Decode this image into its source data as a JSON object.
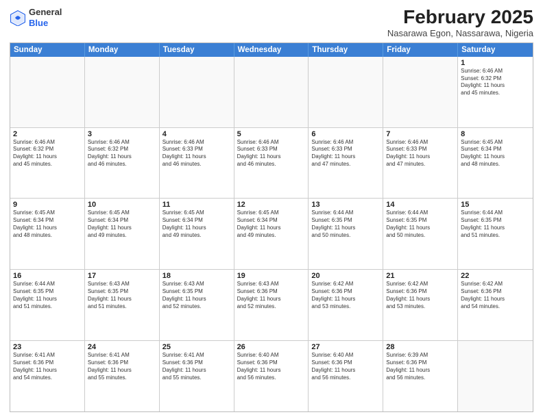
{
  "logo": {
    "general": "General",
    "blue": "Blue"
  },
  "title": "February 2025",
  "location": "Nasarawa Egon, Nassarawa, Nigeria",
  "days": [
    "Sunday",
    "Monday",
    "Tuesday",
    "Wednesday",
    "Thursday",
    "Friday",
    "Saturday"
  ],
  "weeks": [
    [
      {
        "day": "",
        "info": ""
      },
      {
        "day": "",
        "info": ""
      },
      {
        "day": "",
        "info": ""
      },
      {
        "day": "",
        "info": ""
      },
      {
        "day": "",
        "info": ""
      },
      {
        "day": "",
        "info": ""
      },
      {
        "day": "1",
        "info": "Sunrise: 6:46 AM\nSunset: 6:32 PM\nDaylight: 11 hours\nand 45 minutes."
      }
    ],
    [
      {
        "day": "2",
        "info": "Sunrise: 6:46 AM\nSunset: 6:32 PM\nDaylight: 11 hours\nand 45 minutes."
      },
      {
        "day": "3",
        "info": "Sunrise: 6:46 AM\nSunset: 6:32 PM\nDaylight: 11 hours\nand 46 minutes."
      },
      {
        "day": "4",
        "info": "Sunrise: 6:46 AM\nSunset: 6:33 PM\nDaylight: 11 hours\nand 46 minutes."
      },
      {
        "day": "5",
        "info": "Sunrise: 6:46 AM\nSunset: 6:33 PM\nDaylight: 11 hours\nand 46 minutes."
      },
      {
        "day": "6",
        "info": "Sunrise: 6:46 AM\nSunset: 6:33 PM\nDaylight: 11 hours\nand 47 minutes."
      },
      {
        "day": "7",
        "info": "Sunrise: 6:46 AM\nSunset: 6:33 PM\nDaylight: 11 hours\nand 47 minutes."
      },
      {
        "day": "8",
        "info": "Sunrise: 6:45 AM\nSunset: 6:34 PM\nDaylight: 11 hours\nand 48 minutes."
      }
    ],
    [
      {
        "day": "9",
        "info": "Sunrise: 6:45 AM\nSunset: 6:34 PM\nDaylight: 11 hours\nand 48 minutes."
      },
      {
        "day": "10",
        "info": "Sunrise: 6:45 AM\nSunset: 6:34 PM\nDaylight: 11 hours\nand 49 minutes."
      },
      {
        "day": "11",
        "info": "Sunrise: 6:45 AM\nSunset: 6:34 PM\nDaylight: 11 hours\nand 49 minutes."
      },
      {
        "day": "12",
        "info": "Sunrise: 6:45 AM\nSunset: 6:34 PM\nDaylight: 11 hours\nand 49 minutes."
      },
      {
        "day": "13",
        "info": "Sunrise: 6:44 AM\nSunset: 6:35 PM\nDaylight: 11 hours\nand 50 minutes."
      },
      {
        "day": "14",
        "info": "Sunrise: 6:44 AM\nSunset: 6:35 PM\nDaylight: 11 hours\nand 50 minutes."
      },
      {
        "day": "15",
        "info": "Sunrise: 6:44 AM\nSunset: 6:35 PM\nDaylight: 11 hours\nand 51 minutes."
      }
    ],
    [
      {
        "day": "16",
        "info": "Sunrise: 6:44 AM\nSunset: 6:35 PM\nDaylight: 11 hours\nand 51 minutes."
      },
      {
        "day": "17",
        "info": "Sunrise: 6:43 AM\nSunset: 6:35 PM\nDaylight: 11 hours\nand 51 minutes."
      },
      {
        "day": "18",
        "info": "Sunrise: 6:43 AM\nSunset: 6:35 PM\nDaylight: 11 hours\nand 52 minutes."
      },
      {
        "day": "19",
        "info": "Sunrise: 6:43 AM\nSunset: 6:36 PM\nDaylight: 11 hours\nand 52 minutes."
      },
      {
        "day": "20",
        "info": "Sunrise: 6:42 AM\nSunset: 6:36 PM\nDaylight: 11 hours\nand 53 minutes."
      },
      {
        "day": "21",
        "info": "Sunrise: 6:42 AM\nSunset: 6:36 PM\nDaylight: 11 hours\nand 53 minutes."
      },
      {
        "day": "22",
        "info": "Sunrise: 6:42 AM\nSunset: 6:36 PM\nDaylight: 11 hours\nand 54 minutes."
      }
    ],
    [
      {
        "day": "23",
        "info": "Sunrise: 6:41 AM\nSunset: 6:36 PM\nDaylight: 11 hours\nand 54 minutes."
      },
      {
        "day": "24",
        "info": "Sunrise: 6:41 AM\nSunset: 6:36 PM\nDaylight: 11 hours\nand 55 minutes."
      },
      {
        "day": "25",
        "info": "Sunrise: 6:41 AM\nSunset: 6:36 PM\nDaylight: 11 hours\nand 55 minutes."
      },
      {
        "day": "26",
        "info": "Sunrise: 6:40 AM\nSunset: 6:36 PM\nDaylight: 11 hours\nand 56 minutes."
      },
      {
        "day": "27",
        "info": "Sunrise: 6:40 AM\nSunset: 6:36 PM\nDaylight: 11 hours\nand 56 minutes."
      },
      {
        "day": "28",
        "info": "Sunrise: 6:39 AM\nSunset: 6:36 PM\nDaylight: 11 hours\nand 56 minutes."
      },
      {
        "day": "",
        "info": ""
      }
    ]
  ]
}
